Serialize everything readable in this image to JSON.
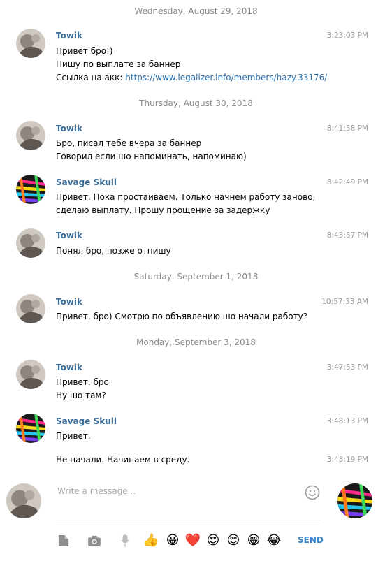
{
  "dates": [
    "Wednesday, August 29, 2018",
    "Thursday, August 30, 2018",
    "Saturday, September 1, 2018",
    "Monday, September 3, 2018"
  ],
  "messages": [
    {
      "author": "Towik",
      "time": "3:23:03 PM",
      "lines": [
        "Привет бро!)",
        "Пишу по выплате за баннер"
      ],
      "link_prefix": "Ссылка на акк: ",
      "link": "https://www.legalizer.info/members/hazy.33176/"
    },
    {
      "author": "Towik",
      "time": "8:41:58 PM",
      "lines": [
        "Бро, писал тебе вчера за баннер",
        "Говорил если шо напоминать, напоминаю)"
      ]
    },
    {
      "author": "Savage Skull",
      "time": "8:42:49 PM",
      "lines": [
        "Привет. Пока простаиваем. Только начнем работу заново,",
        "сделаю выплату. Прошу прощение за задержку"
      ]
    },
    {
      "author": "Towik",
      "time": "8:43:57 PM",
      "lines": [
        "Понял бро, позже отпишу"
      ]
    },
    {
      "author": "Towik",
      "time": "10:57:33 AM",
      "lines": [
        "Привет, бро) Смотрю по объявлению шо начали работу?"
      ]
    },
    {
      "author": "Towik",
      "time": "3:47:53 PM",
      "lines": [
        "Привет, бро",
        "Ну шо там?"
      ]
    },
    {
      "author": "Savage Skull",
      "time": "3:48:13 PM",
      "lines": [
        "Привет."
      ]
    },
    {
      "author": "",
      "time": "3:48:19 PM",
      "lines": [
        "Не начали. Начинаем в среду."
      ]
    }
  ],
  "composer": {
    "placeholder": "Write a message...",
    "send_label": "SEND"
  },
  "toolbar": {
    "icons": [
      "file-icon",
      "camera-icon",
      "microphone-icon",
      "thumbs-up-icon",
      "grinning-icon",
      "heart-icon",
      "heart-eyes-icon",
      "smile-icon",
      "grin-icon",
      "tears-of-joy-icon"
    ],
    "emoji": [
      "👍",
      "😀",
      "❤️",
      "😍",
      "😊",
      "😁",
      "😂"
    ]
  },
  "colors": {
    "name": "#3a6d99",
    "link": "#2a6fad",
    "send": "#3a86c8",
    "meta": "#9a9a9a"
  }
}
